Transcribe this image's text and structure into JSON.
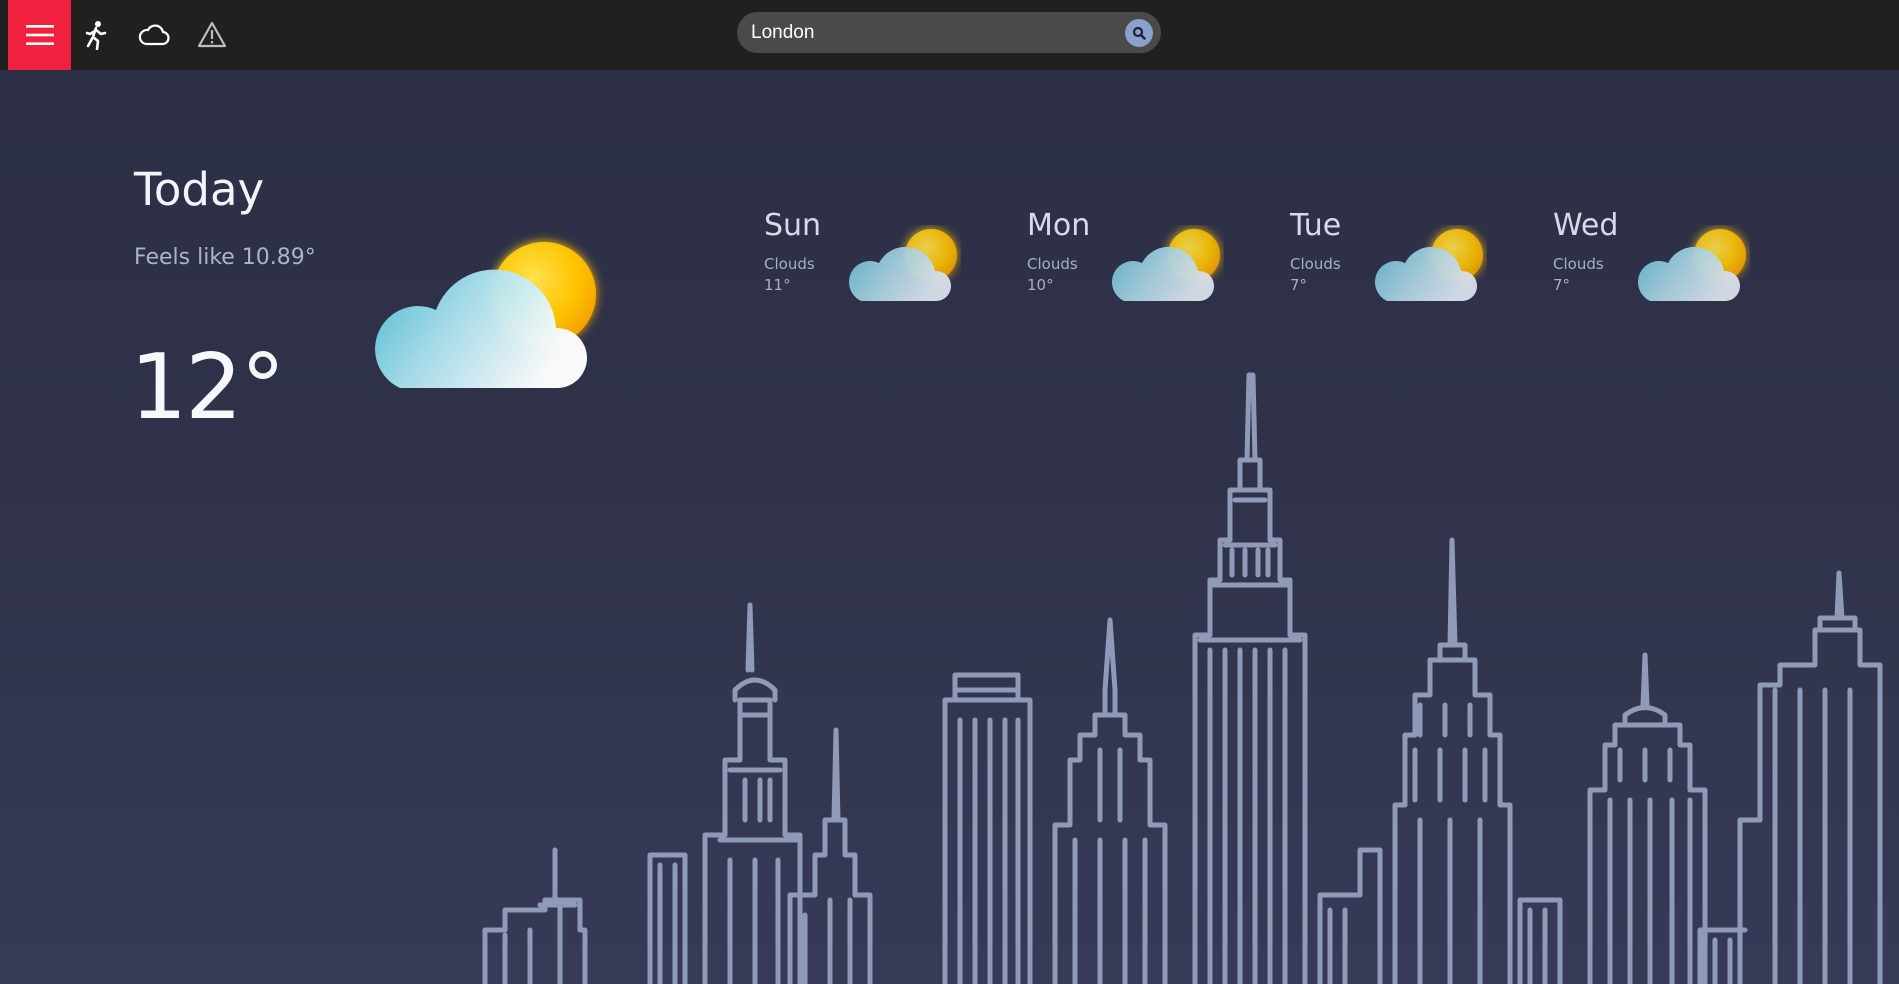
{
  "topbar": {
    "menu_icon": "hamburger-menu-icon",
    "nav_icons": [
      "running-person-icon",
      "cloud-icon",
      "warning-triangle-icon"
    ],
    "search": {
      "value": "London",
      "placeholder": "",
      "button_icon": "search-icon"
    }
  },
  "today": {
    "title": "Today",
    "feels_like": "Feels like 10.89°",
    "temperature": "12°",
    "icon": "partly-cloudy-icon"
  },
  "forecast": [
    {
      "day": "Sun",
      "description": "Clouds",
      "temp": "11°",
      "icon": "partly-cloudy-icon"
    },
    {
      "day": "Mon",
      "description": "Clouds",
      "temp": "10°",
      "icon": "partly-cloudy-icon"
    },
    {
      "day": "Tue",
      "description": "Clouds",
      "temp": "7°",
      "icon": "partly-cloudy-icon"
    },
    {
      "day": "Wed",
      "description": "Clouds",
      "temp": "7°",
      "icon": "partly-cloudy-icon"
    }
  ],
  "background": {
    "illustration": "city-skyline-illustration"
  },
  "colors": {
    "topbar": "#202020",
    "menu_accent": "#f0203f",
    "background_top": "#2b2e44",
    "background_bottom": "#363a57",
    "skyline_stroke": "#8e9ab8",
    "sun": "#f7b800"
  }
}
